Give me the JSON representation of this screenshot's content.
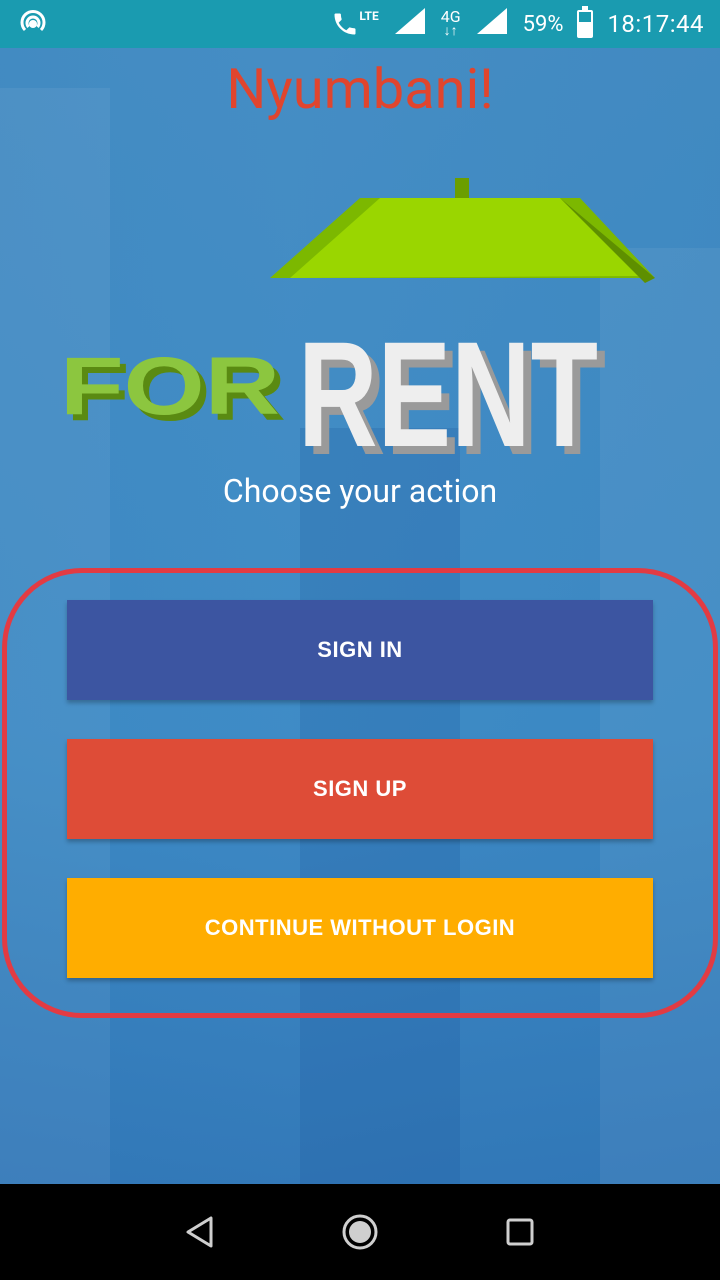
{
  "status_bar": {
    "lte_label": "LTE",
    "network_label": "4G",
    "battery": "59%",
    "battery_level": 0.59,
    "time": "18:17:44"
  },
  "app": {
    "title": "Nyumbani!",
    "logo": {
      "word1": "FOR",
      "word2": "RENT",
      "colors": {
        "green": "#8cc63f",
        "roof": "#9ad600",
        "white": "#eeeeee"
      }
    },
    "subtitle": "Choose your action",
    "buttons": {
      "sign_in": "SIGN IN",
      "sign_up": "SIGN UP",
      "continue": "CONTINUE WITHOUT LOGIN"
    }
  },
  "colors": {
    "status_bar": "#1a9bb0",
    "title": "#e0452e",
    "sign_in": "#3c55a1",
    "sign_up": "#de4c37",
    "continue": "#ffad00",
    "highlight": "#e23b43"
  },
  "navbar": {
    "icons": [
      "back-icon",
      "home-icon",
      "recents-icon"
    ]
  }
}
